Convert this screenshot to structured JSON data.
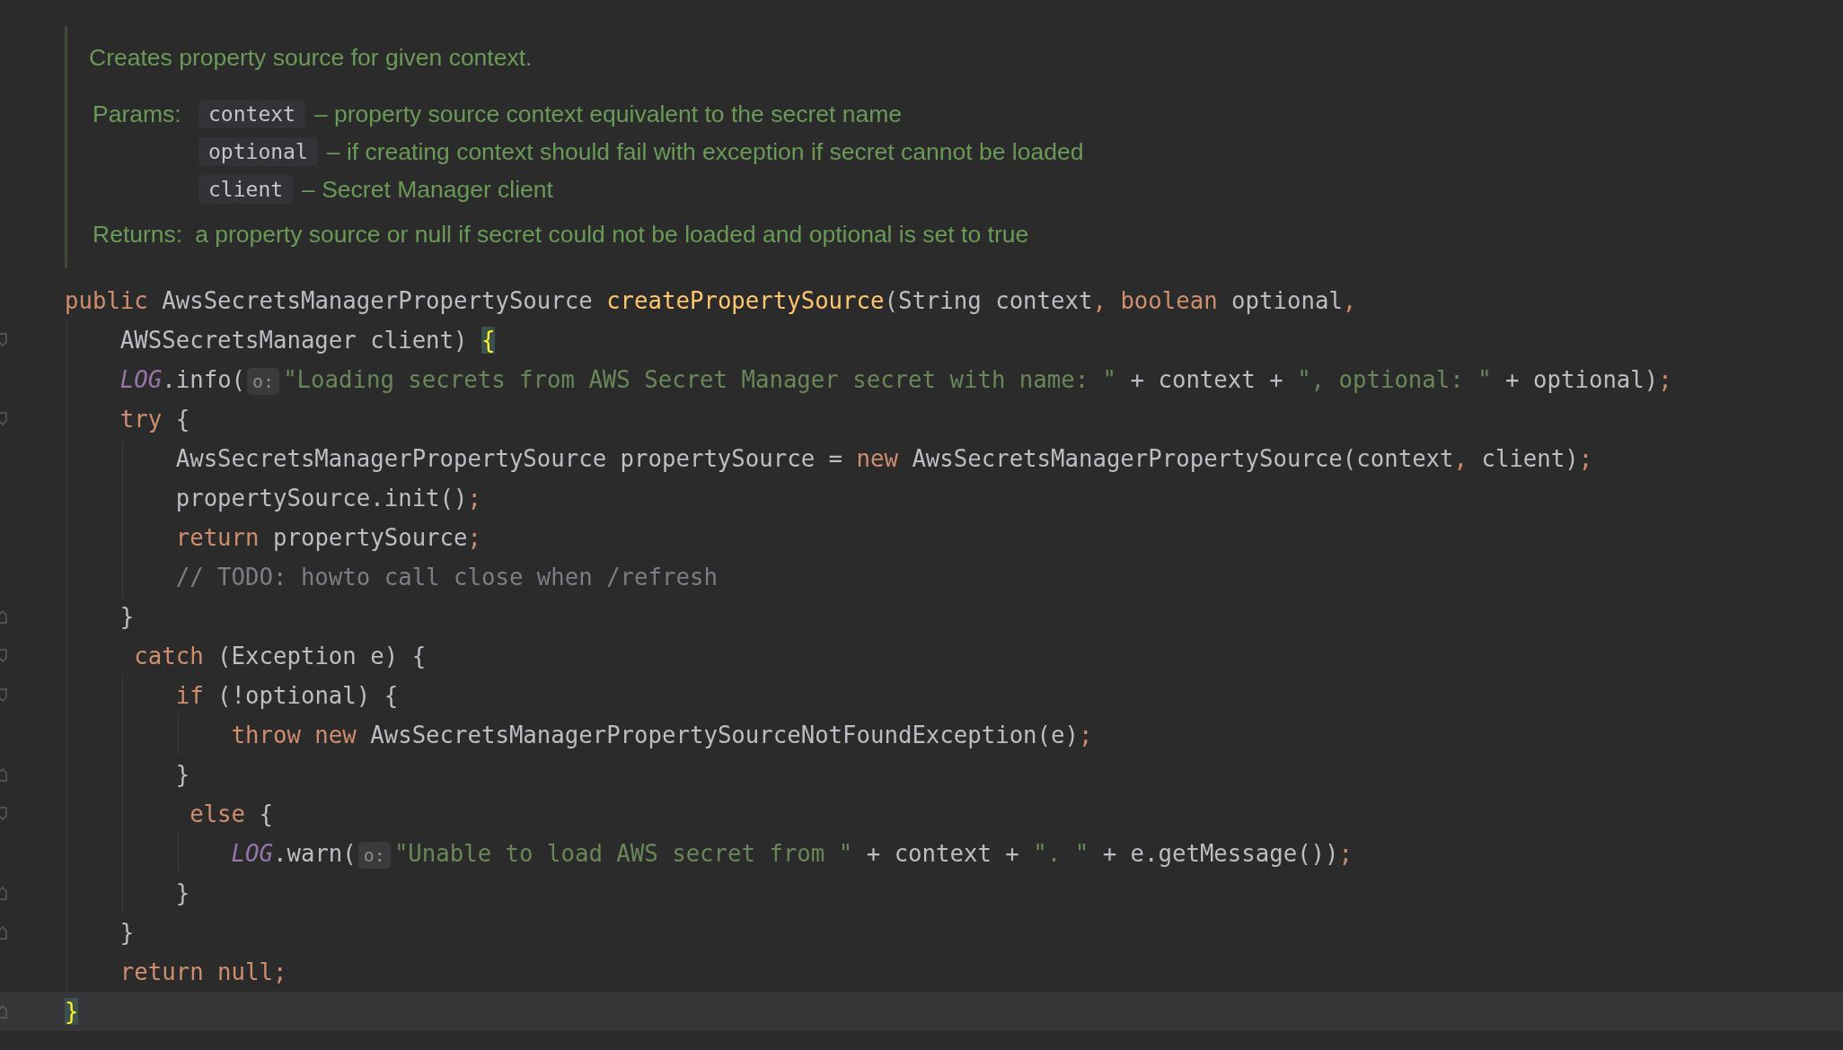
{
  "doc": {
    "summary": "Creates property source for given context.",
    "params_label": "Params:",
    "params": [
      {
        "name": "context",
        "description": "– property source context equivalent to the secret name"
      },
      {
        "name": "optional",
        "description": "– if creating context should fail with exception if secret cannot be loaded"
      },
      {
        "name": "client",
        "description": "– Secret Manager client"
      }
    ],
    "returns_label": "Returns:",
    "returns_text": "a property source or null if secret could not be loaded and optional is set to true"
  },
  "code_lines": [
    {
      "current": false,
      "tokens": [
        {
          "kind": "kw",
          "text": "public"
        },
        {
          "kind": "plain",
          "text": " AwsSecretsManagerPropertySource "
        },
        {
          "kind": "decl",
          "text": "createPropertySource"
        },
        {
          "kind": "plain",
          "text": "(String context"
        },
        {
          "kind": "punct",
          "text": ", "
        },
        {
          "kind": "kw",
          "text": "boolean"
        },
        {
          "kind": "plain",
          "text": " optional"
        },
        {
          "kind": "punct",
          "text": ","
        }
      ]
    },
    {
      "fold": {
        "kind": "start"
      },
      "current": false,
      "tokens": [
        {
          "kind": "plain",
          "text": "    AWSSecretsManager client) "
        },
        {
          "kind": "brace",
          "text": "{"
        }
      ]
    },
    {
      "current": false,
      "tokens": [
        {
          "kind": "static",
          "text": "    LOG"
        },
        {
          "kind": "plain",
          "text": ".info("
        },
        {
          "kind": "hint",
          "text": "o:"
        },
        {
          "kind": "str",
          "text": "\"Loading secrets from AWS Secret Manager secret with name: \""
        },
        {
          "kind": "plain",
          "text": " + context + "
        },
        {
          "kind": "str",
          "text": "\", optional: \""
        },
        {
          "kind": "plain",
          "text": " + optional)"
        },
        {
          "kind": "punct",
          "text": ";"
        }
      ]
    },
    {
      "fold": {
        "kind": "start"
      },
      "current": false,
      "tokens": [
        {
          "kind": "kw",
          "text": "    try"
        },
        {
          "kind": "plain",
          "text": " {"
        }
      ]
    },
    {
      "current": false,
      "tokens": [
        {
          "kind": "plain",
          "text": "        AwsSecretsManagerPropertySource propertySource = "
        },
        {
          "kind": "kw",
          "text": "new"
        },
        {
          "kind": "plain",
          "text": " AwsSecretsManagerPropertySource(context"
        },
        {
          "kind": "punct",
          "text": ","
        },
        {
          "kind": "plain",
          "text": " client)"
        },
        {
          "kind": "punct",
          "text": ";"
        }
      ]
    },
    {
      "current": false,
      "tokens": [
        {
          "kind": "plain",
          "text": "        propertySource.init()"
        },
        {
          "kind": "punct",
          "text": ";"
        }
      ]
    },
    {
      "current": false,
      "tokens": [
        {
          "kind": "kw",
          "text": "        return"
        },
        {
          "kind": "plain",
          "text": " propertySource"
        },
        {
          "kind": "punct",
          "text": ";"
        }
      ]
    },
    {
      "current": false,
      "tokens": [
        {
          "kind": "comment",
          "text": "        // TODO: howto call close when /refresh"
        }
      ]
    },
    {
      "fold": {
        "kind": "end"
      },
      "current": false,
      "tokens": [
        {
          "kind": "plain",
          "text": "    }"
        }
      ]
    },
    {
      "fold": {
        "kind": "start"
      },
      "current": false,
      "tokens": [
        {
          "kind": "kw",
          "text": "     catch"
        },
        {
          "kind": "plain",
          "text": " (Exception e) {"
        }
      ]
    },
    {
      "fold": {
        "kind": "start"
      },
      "current": false,
      "tokens": [
        {
          "kind": "kw",
          "text": "        if"
        },
        {
          "kind": "plain",
          "text": " (!optional) {"
        }
      ]
    },
    {
      "current": false,
      "tokens": [
        {
          "kind": "kw",
          "text": "            throw new"
        },
        {
          "kind": "plain",
          "text": " AwsSecretsManagerPropertySourceNotFoundException(e)"
        },
        {
          "kind": "punct",
          "text": ";"
        }
      ]
    },
    {
      "fold": {
        "kind": "end"
      },
      "current": false,
      "tokens": [
        {
          "kind": "plain",
          "text": "        }"
        }
      ]
    },
    {
      "fold": {
        "kind": "start"
      },
      "current": false,
      "tokens": [
        {
          "kind": "kw",
          "text": "         else"
        },
        {
          "kind": "plain",
          "text": " {"
        }
      ]
    },
    {
      "current": false,
      "tokens": [
        {
          "kind": "static",
          "text": "            LOG"
        },
        {
          "kind": "plain",
          "text": ".warn("
        },
        {
          "kind": "hint",
          "text": "o:"
        },
        {
          "kind": "str",
          "text": "\"Unable to load AWS secret from \""
        },
        {
          "kind": "plain",
          "text": " + context + "
        },
        {
          "kind": "str",
          "text": "\". \""
        },
        {
          "kind": "plain",
          "text": " + e.getMessage())"
        },
        {
          "kind": "punct",
          "text": ";"
        }
      ]
    },
    {
      "fold": {
        "kind": "end"
      },
      "current": false,
      "tokens": [
        {
          "kind": "plain",
          "text": "        }"
        }
      ]
    },
    {
      "fold": {
        "kind": "end"
      },
      "current": false,
      "tokens": [
        {
          "kind": "plain",
          "text": "    }"
        }
      ]
    },
    {
      "current": false,
      "tokens": [
        {
          "kind": "kw",
          "text": "    return null;"
        }
      ]
    },
    {
      "fold": {
        "kind": "end"
      },
      "current": true,
      "tokens": [
        {
          "kind": "brace",
          "text": "}"
        }
      ]
    }
  ]
}
